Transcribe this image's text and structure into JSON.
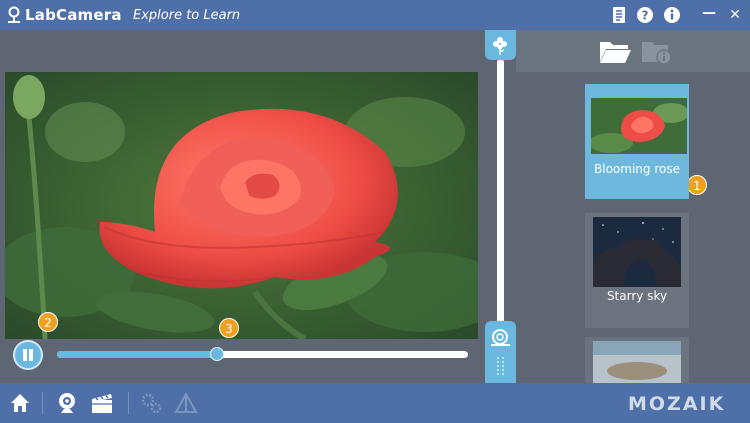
{
  "app": {
    "title": "LabCamera",
    "subtitle": "Explore to Learn",
    "brand": "MOZAIK"
  },
  "window_buttons": {
    "minimize": "—",
    "close": "✕"
  },
  "player": {
    "progress": 0.39,
    "vertical_slider_level": 0.0,
    "state": "playing"
  },
  "badges": [
    "1",
    "2",
    "3"
  ],
  "gallery": [
    {
      "label": "Blooming rose",
      "selected": true
    },
    {
      "label": "Starry sky",
      "selected": false
    },
    {
      "label": "",
      "selected": false
    }
  ],
  "colors": {
    "titlebar": "#4f6fa8",
    "accent": "#6ab7df",
    "badge": "#f0a020",
    "panel": "#5d6672"
  },
  "icons": {
    "title": "labcamera-logo-icon",
    "window": [
      "notes-icon",
      "help-icon",
      "info-icon",
      "minimize-icon",
      "close-icon"
    ],
    "tabs": [
      "folder-open-icon",
      "folder-info-icon"
    ],
    "slider": [
      "flower-icon",
      "snail-icon",
      "grip-icon"
    ],
    "toolbar": [
      "home-icon",
      "webcam-icon",
      "clapperboard-icon",
      "settings-gears-icon",
      "triangle-icon"
    ]
  }
}
